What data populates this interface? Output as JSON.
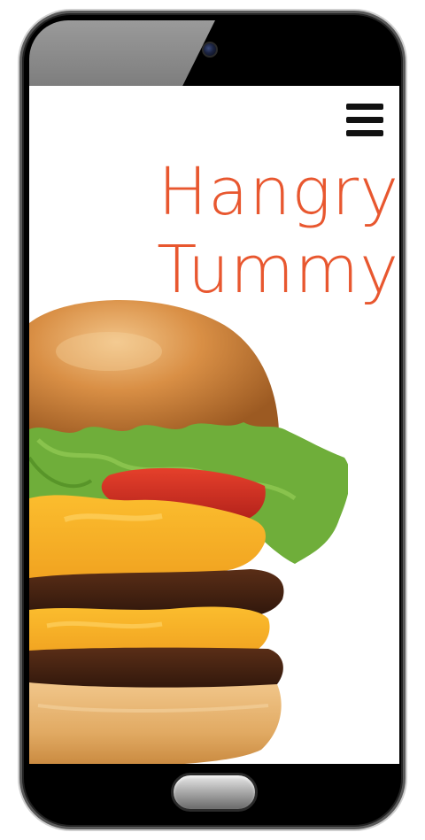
{
  "app": {
    "title_line1": "Hangry",
    "title_line2": "Tummy",
    "accent_color": "#e8572f"
  },
  "header": {
    "menu_icon": "hamburger-menu-icon"
  },
  "hero": {
    "image": "cheeseburger-photo"
  },
  "device": {
    "camera": "front-camera",
    "home_button": "home-button"
  }
}
